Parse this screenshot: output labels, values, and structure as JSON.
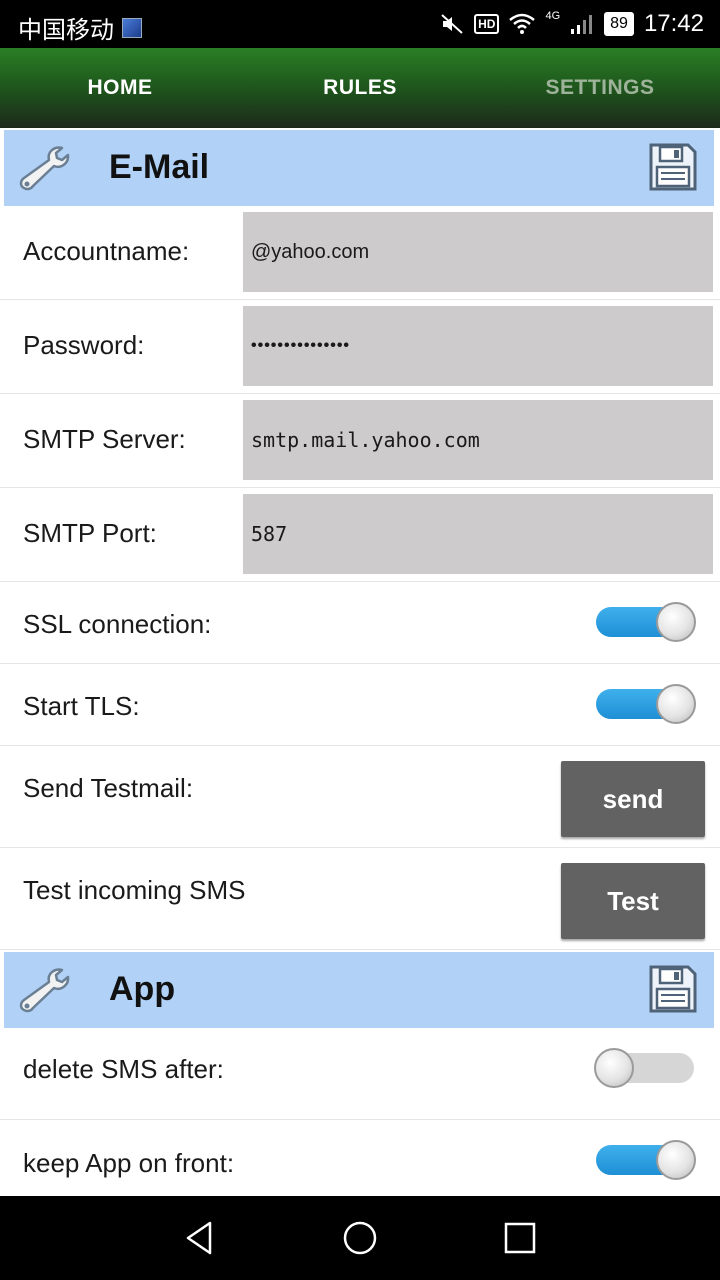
{
  "status_bar": {
    "carrier": "中国移动",
    "network": "4G",
    "battery": "89",
    "time": "17:42",
    "icons": [
      "sim-icon",
      "mute-icon",
      "hd-icon",
      "wifi-icon",
      "signal-icon",
      "battery-icon"
    ]
  },
  "tabs": [
    {
      "label": "HOME"
    },
    {
      "label": "RULES"
    },
    {
      "label": "SETTINGS"
    }
  ],
  "email_section": {
    "title": "E-Mail",
    "icons": [
      "wrench-icon",
      "save-icon"
    ],
    "accountname_label": "Accountname:",
    "accountname_value": "@yahoo.com",
    "password_label": "Password:",
    "password_value": "•••••••••••••••",
    "smtp_server_label": "SMTP Server:",
    "smtp_server_value": "smtp.mail.yahoo.com",
    "smtp_port_label": "SMTP Port:",
    "smtp_port_value": "587",
    "ssl_label": "SSL connection:",
    "ssl_enabled": true,
    "tls_label": "Start TLS:",
    "tls_enabled": true,
    "testmail_label": "Send Testmail:",
    "send_button": "send",
    "test_sms_label": "Test incoming SMS",
    "test_button": "Test"
  },
  "app_section": {
    "title": "App",
    "icons": [
      "wrench-icon",
      "save-icon"
    ],
    "delete_sms_label": "delete SMS after:",
    "delete_sms_enabled": false,
    "keep_front_label": "keep App on front:",
    "keep_front_enabled": true
  },
  "colors": {
    "tab_bar": "#2a7f25",
    "section_header": "#b1d1f6",
    "field_bg": "#cdcbcc",
    "button_bg": "#636263",
    "toggle_on": "#1f8fd6"
  },
  "nav_bar": {
    "icons": [
      "back-icon",
      "home-icon",
      "recents-icon"
    ]
  }
}
